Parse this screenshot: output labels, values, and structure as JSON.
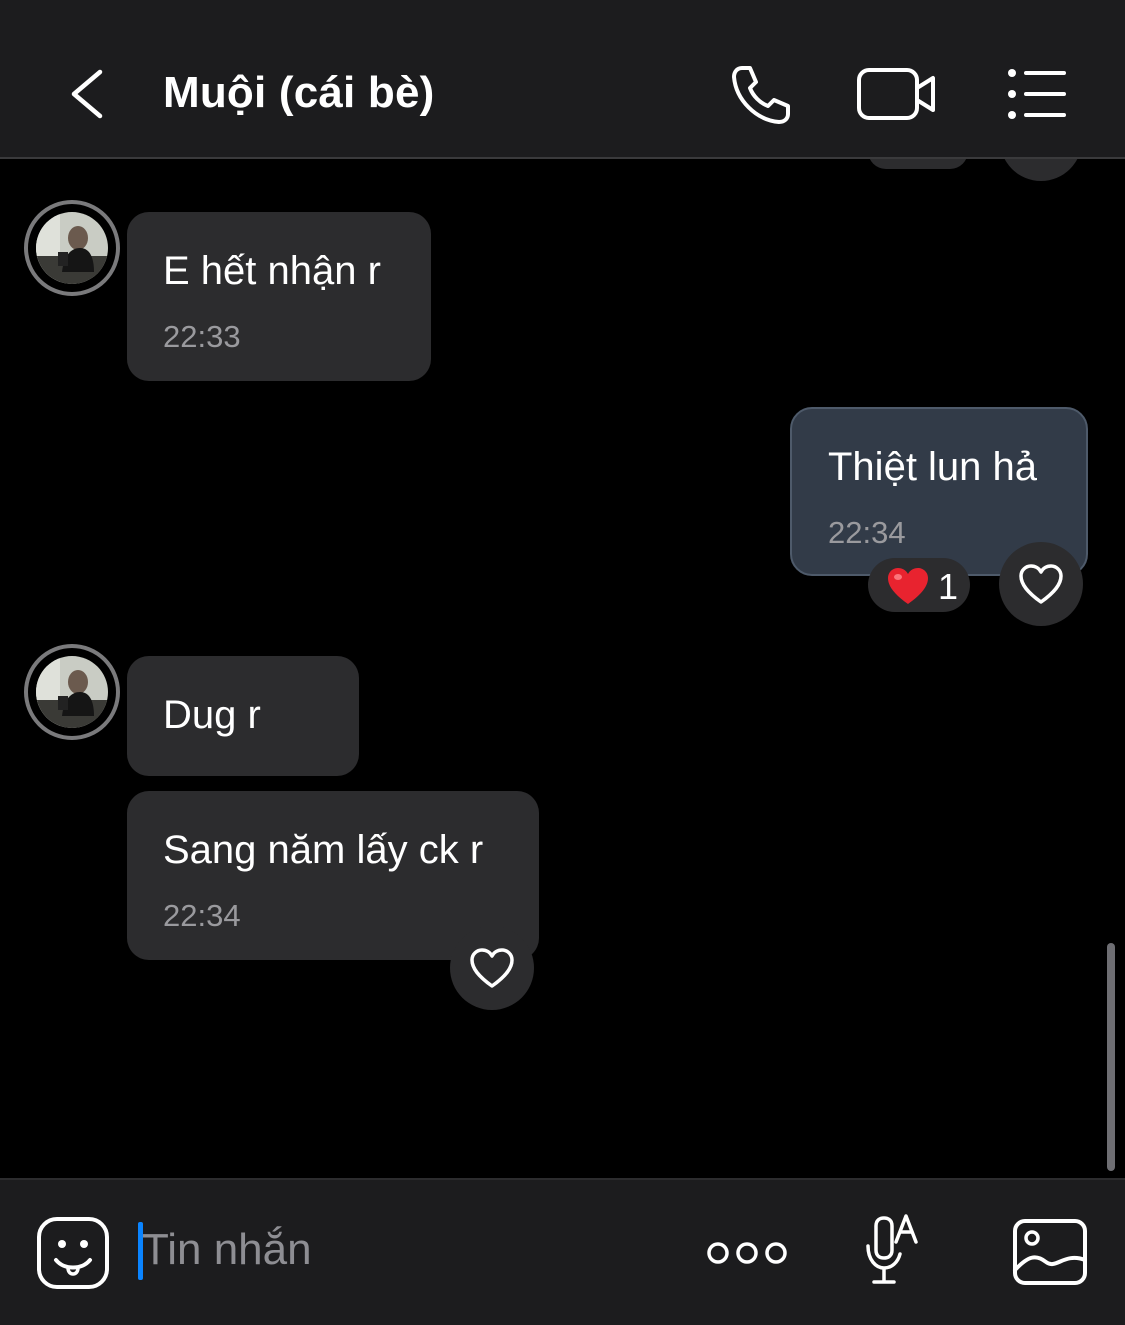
{
  "header": {
    "title": "Muội (cái bè)",
    "icons": {
      "back": "chevron-left-icon",
      "call": "phone-icon",
      "video": "video-camera-icon",
      "menu": "list-menu-icon"
    }
  },
  "messages": [
    {
      "sender": "contact",
      "text": "E hết nhận r",
      "time": "22:33"
    },
    {
      "sender": "me",
      "text": "Thiệt lun hả",
      "time": "22:34",
      "reaction": {
        "emoji": "red-heart",
        "count": "1"
      }
    },
    {
      "sender": "contact",
      "text": "Dug r"
    },
    {
      "sender": "contact",
      "text": "Sang năm lấy ck r",
      "time": "22:34"
    }
  ],
  "composer": {
    "placeholder": "Tin nhắn",
    "value": "",
    "icons": {
      "emoji": "sticker-face-icon",
      "more": "more-options-icon",
      "mic": "voice-to-text-mic-icon",
      "image": "image-gallery-icon"
    }
  },
  "colors": {
    "background": "#000000",
    "header_bg": "#1c1c1e",
    "incoming_bubble": "#2c2c2e",
    "outgoing_bubble": "#323b48",
    "accent": "#0a84ff",
    "time_text": "#9a9a9e"
  }
}
